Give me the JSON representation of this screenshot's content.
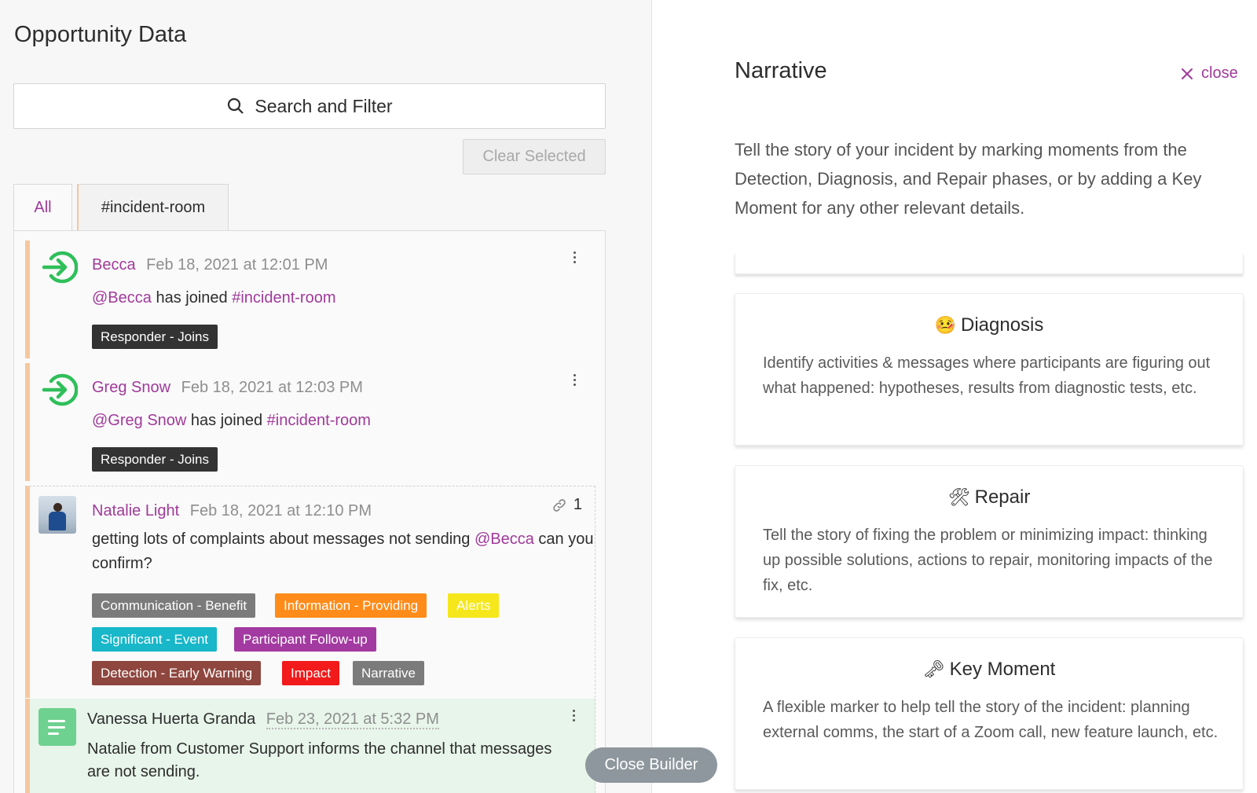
{
  "left": {
    "title": "Opportunity Data",
    "search_label": "Search and Filter",
    "clear_selected": "Clear Selected",
    "tabs": [
      {
        "label": "All",
        "active": true
      },
      {
        "label": "#incident-room",
        "active": false
      }
    ]
  },
  "messages": [
    {
      "author": "Becca",
      "time": "Feb 18, 2021 at 12:01 PM",
      "mention": "@Becca",
      "text": "has joined",
      "channel": "#incident-room",
      "tags": [
        {
          "label": "Responder - Joins",
          "color": "#333333"
        }
      ]
    },
    {
      "author": "Greg Snow",
      "time": "Feb 18, 2021 at 12:03 PM",
      "mention": "@Greg Snow",
      "text": "has joined",
      "channel": "#incident-room",
      "tags": [
        {
          "label": "Responder - Joins",
          "color": "#333333"
        }
      ]
    },
    {
      "author": "Natalie Light",
      "time": "Feb 18, 2021 at 12:10 PM",
      "text_before": "getting lots of complaints about messages not sending",
      "mention": "@Becca",
      "text_after": "can you confirm?",
      "link_count": "1",
      "tags": [
        {
          "label": "Communication - Benefit",
          "color": "#7b7b7b"
        },
        {
          "label": "Information - Providing",
          "color": "#ff8c1a"
        },
        {
          "label": "Alerts",
          "color": "#f5e71c"
        },
        {
          "label": "Significant - Event",
          "color": "#18b7c9"
        },
        {
          "label": "Participant Follow-up",
          "color": "#a33aa1"
        },
        {
          "label": "Detection - Early Warning",
          "color": "#8e463e"
        },
        {
          "label": "Impact",
          "color": "#f21a1a"
        },
        {
          "label": "Narrative",
          "color": "#7b7b7b"
        }
      ]
    },
    {
      "author": "Vanessa Huerta Granda",
      "time": "Feb 23, 2021 at 5:32 PM",
      "text": "Natalie from Customer Support informs the channel that messages are not sending."
    }
  ],
  "close_builder": "Close Builder",
  "narrative": {
    "title": "Narrative",
    "close_label": "close",
    "intro": "Tell the story of your incident by marking moments from the Detection, Diagnosis, and Repair phases, or by adding a Key Moment for any other relevant details.",
    "cards": [
      {
        "emoji": "🤒",
        "icon": "sick-face-icon",
        "title": "Diagnosis",
        "desc": "Identify activities & messages where participants are figuring out what happened: hypotheses, results from diagnostic tests, etc."
      },
      {
        "emoji": "🛠",
        "icon": "tools-icon",
        "title": "Repair",
        "desc": "Tell the story of fixing the problem or minimizing impact: thinking up possible solutions, actions to repair, monitoring impacts of the fix, etc."
      },
      {
        "emoji": "🗝",
        "icon": "key-icon",
        "title": "Key Moment",
        "desc": "A flexible marker to help tell the story of the incident: planning external comms, the start of a Zoom call, new feature launch, etc."
      }
    ]
  },
  "colors": {
    "accent": "#a03a9a",
    "join_green": "#2fbf5a",
    "left_rail": "#f6c79f",
    "note_bg": "#e7f5ea"
  }
}
